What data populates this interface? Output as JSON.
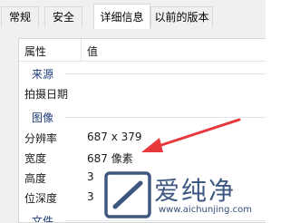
{
  "tabs": [
    "常规",
    "安全",
    "详细信息",
    "以前的版本"
  ],
  "columns": {
    "property": "属性",
    "value": "值"
  },
  "groups": {
    "source": "来源",
    "image": "图像",
    "file": "文件"
  },
  "rows": {
    "date_taken": {
      "label": "拍摄日期",
      "value": ""
    },
    "dimensions": {
      "label": "分辨率",
      "value": "687 x 379"
    },
    "width": {
      "label": "宽度",
      "value": "687 像素"
    },
    "height": {
      "label": "高度",
      "value": "3"
    },
    "bit_depth": {
      "label": "位深度",
      "value": "3"
    }
  },
  "watermark": {
    "brand": "爱纯净",
    "url": "www.aichunjing.com"
  },
  "colors": {
    "arrow": "#e8383d",
    "group": "#1e3c78",
    "watermark": "#1d3a6b"
  }
}
